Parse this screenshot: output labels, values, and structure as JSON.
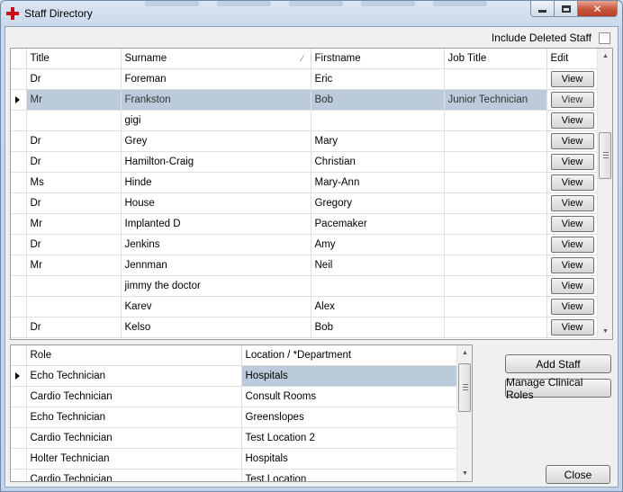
{
  "window": {
    "title": "Staff Directory",
    "controls": {
      "minimize_icon": "minimize-icon",
      "maximize_icon": "maximize-icon",
      "close_glyph": "✕"
    }
  },
  "filters": {
    "include_deleted_label": "Include Deleted Staff",
    "include_deleted_checked": false
  },
  "staff_grid": {
    "columns": [
      "Title",
      "Surname",
      "Firstname",
      "Job Title",
      "Edit"
    ],
    "sorted_column": "Surname",
    "edit_button_label": "View",
    "selected_index": 1,
    "rows": [
      {
        "title": "Dr",
        "surname": "Foreman",
        "firstname": "Eric",
        "job_title": ""
      },
      {
        "title": "Mr",
        "surname": "Frankston",
        "firstname": "Bob",
        "job_title": "Junior Technician"
      },
      {
        "title": "",
        "surname": "gigi",
        "firstname": "",
        "job_title": ""
      },
      {
        "title": "Dr",
        "surname": "Grey",
        "firstname": "Mary",
        "job_title": ""
      },
      {
        "title": "Dr",
        "surname": "Hamilton-Craig",
        "firstname": "Christian",
        "job_title": ""
      },
      {
        "title": "Ms",
        "surname": "Hinde",
        "firstname": "Mary-Ann",
        "job_title": ""
      },
      {
        "title": "Dr",
        "surname": "House",
        "firstname": "Gregory",
        "job_title": ""
      },
      {
        "title": "Mr",
        "surname": "Implanted D",
        "firstname": "Pacemaker",
        "job_title": ""
      },
      {
        "title": "Dr",
        "surname": "Jenkins",
        "firstname": "Amy",
        "job_title": ""
      },
      {
        "title": "Mr",
        "surname": "Jennman",
        "firstname": "Neil",
        "job_title": ""
      },
      {
        "title": "",
        "surname": "jimmy the doctor",
        "firstname": "",
        "job_title": ""
      },
      {
        "title": "",
        "surname": "Karev",
        "firstname": "Alex",
        "job_title": ""
      },
      {
        "title": "Dr",
        "surname": "Kelso",
        "firstname": "Bob",
        "job_title": ""
      }
    ]
  },
  "roles_grid": {
    "columns": [
      "Role",
      "Location / *Department"
    ],
    "selected_index": 0,
    "rows": [
      {
        "role": "Echo Technician",
        "location": "Hospitals"
      },
      {
        "role": "Cardio Technician",
        "location": "Consult Rooms"
      },
      {
        "role": "Echo Technician",
        "location": "Greenslopes"
      },
      {
        "role": "Cardio Technician",
        "location": "Test Location 2"
      },
      {
        "role": "Holter Technician",
        "location": "Hospitals"
      },
      {
        "role": "Cardio Technician",
        "location": "Test Location"
      }
    ]
  },
  "actions": {
    "add_staff": "Add Staff",
    "manage_clinical_roles": "Manage Clinical Roles",
    "close": "Close"
  },
  "colors": {
    "selection": "#bccbdb",
    "close_button": "#c8553d",
    "app_icon": "#c8101a"
  }
}
